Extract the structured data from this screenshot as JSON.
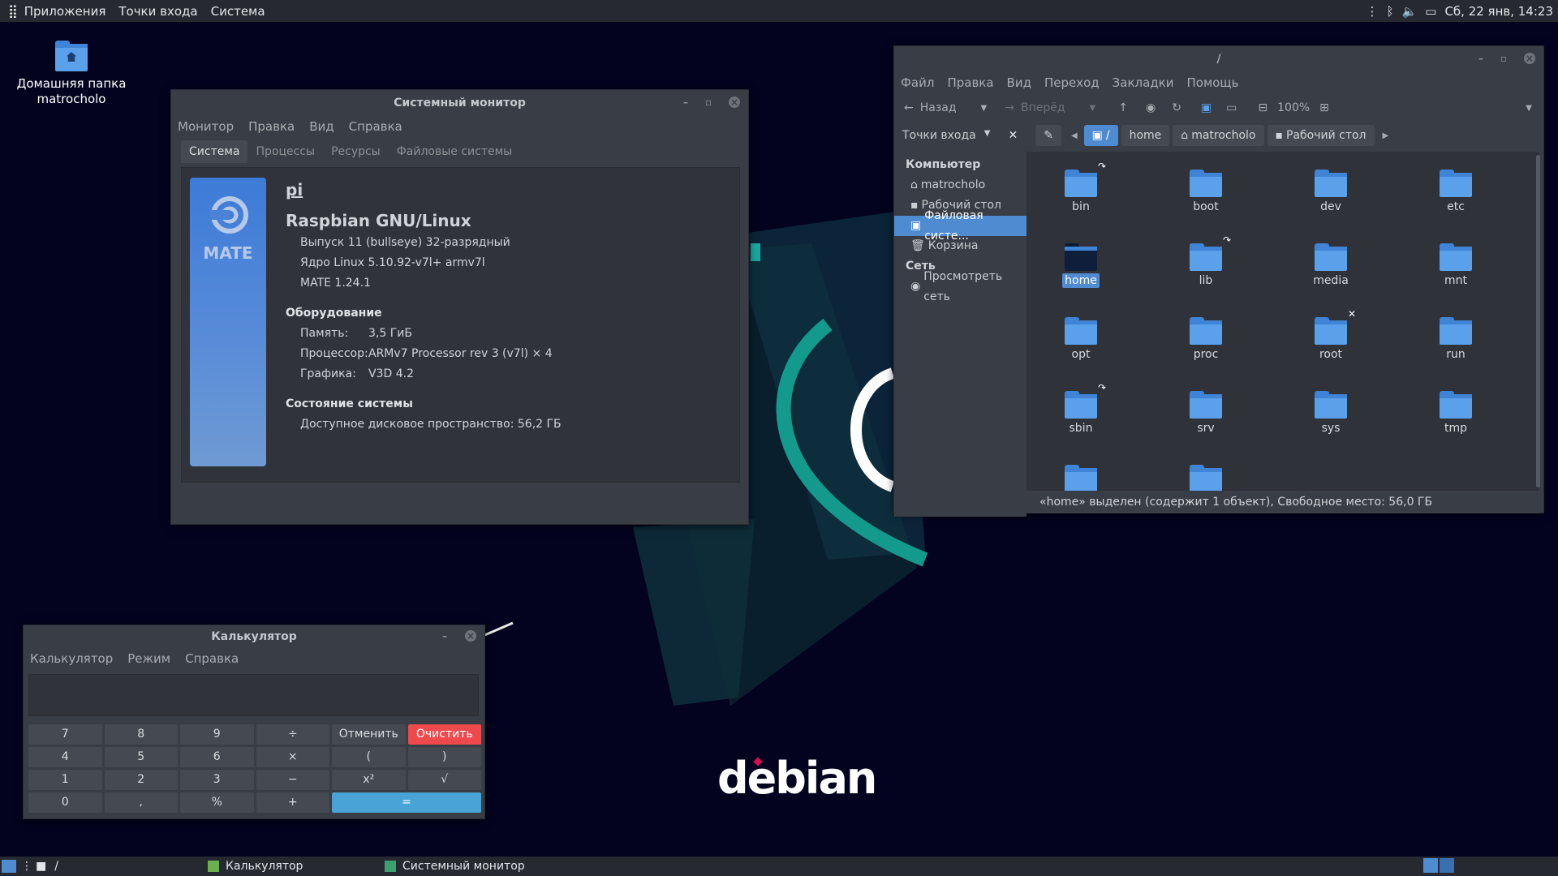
{
  "top_panel": {
    "menu": [
      "Приложения",
      "Точки входа",
      "Система"
    ],
    "datetime": "Сб, 22 янв, 14:23"
  },
  "desktop": {
    "home_icon_label_1": "Домашняя папка",
    "home_icon_label_2": "matrocholo",
    "wallpaper_text": "debian"
  },
  "sysmon": {
    "title": "Системный монитор",
    "menu": [
      "Монитор",
      "Правка",
      "Вид",
      "Справка"
    ],
    "tabs": [
      "Система",
      "Процессы",
      "Ресурсы",
      "Файловые системы"
    ],
    "logo_text": "MATE",
    "hostname": "pi",
    "os": "Raspbian GNU/Linux",
    "release": "Выпуск 11 (bullseye) 32-разрядный",
    "kernel": "Ядро Linux 5.10.92-v7l+ armv7l",
    "mate": "MATE 1.24.1",
    "hw_header": "Оборудование",
    "mem_label": "Память:",
    "mem_value": "3,5 ГиБ",
    "cpu_label": "Процессор:",
    "cpu_value": "ARMv7 Processor rev 3 (v7l) × 4",
    "gpu_label": "Графика:",
    "gpu_value": "V3D 4.2",
    "status_header": "Состояние системы",
    "disk_label": "Доступное дисковое пространство:",
    "disk_value": "56,2 ГБ"
  },
  "fm": {
    "title": "/",
    "menu": [
      "Файл",
      "Правка",
      "Вид",
      "Переход",
      "Закладки",
      "Помощь"
    ],
    "back": "Назад",
    "forward": "Вперёд",
    "zoom": "100%",
    "places_selector": "Точки входа",
    "path": [
      "/",
      "home",
      "matrocholo",
      "Рабочий стол"
    ],
    "sidebar": {
      "computer": "Компьютер",
      "items": [
        "matrocholo",
        "Рабочий стол",
        "Файловая систе...",
        "Корзина"
      ],
      "network": "Сеть",
      "browse": "Просмотреть сеть"
    },
    "files": [
      "bin",
      "boot",
      "dev",
      "etc",
      "home",
      "lib",
      "media",
      "mnt",
      "opt",
      "proc",
      "root",
      "run",
      "sbin",
      "srv",
      "sys",
      "tmp",
      "",
      ""
    ],
    "status": "«home» выделен (содержит 1 объект), Свободное место: 56,0 ГБ"
  },
  "calc": {
    "title": "Калькулятор",
    "menu": [
      "Калькулятор",
      "Режим",
      "Справка"
    ],
    "keys": [
      "7",
      "8",
      "9",
      "÷",
      "Отменить",
      "Очистить",
      "4",
      "5",
      "6",
      "×",
      "(",
      ")",
      "1",
      "2",
      "3",
      "−",
      "x²",
      "√",
      "0",
      ",",
      "%",
      "+",
      "="
    ]
  },
  "bottom_panel": {
    "path": "/",
    "tasks": [
      "Калькулятор",
      "Системный монитор"
    ]
  },
  "colors": {
    "accent": "#4e8bd1",
    "clear_button": "#ee4a4d",
    "equals_button": "#4aa3d6",
    "folder": "#5aa0ea",
    "background": "#03031f"
  }
}
